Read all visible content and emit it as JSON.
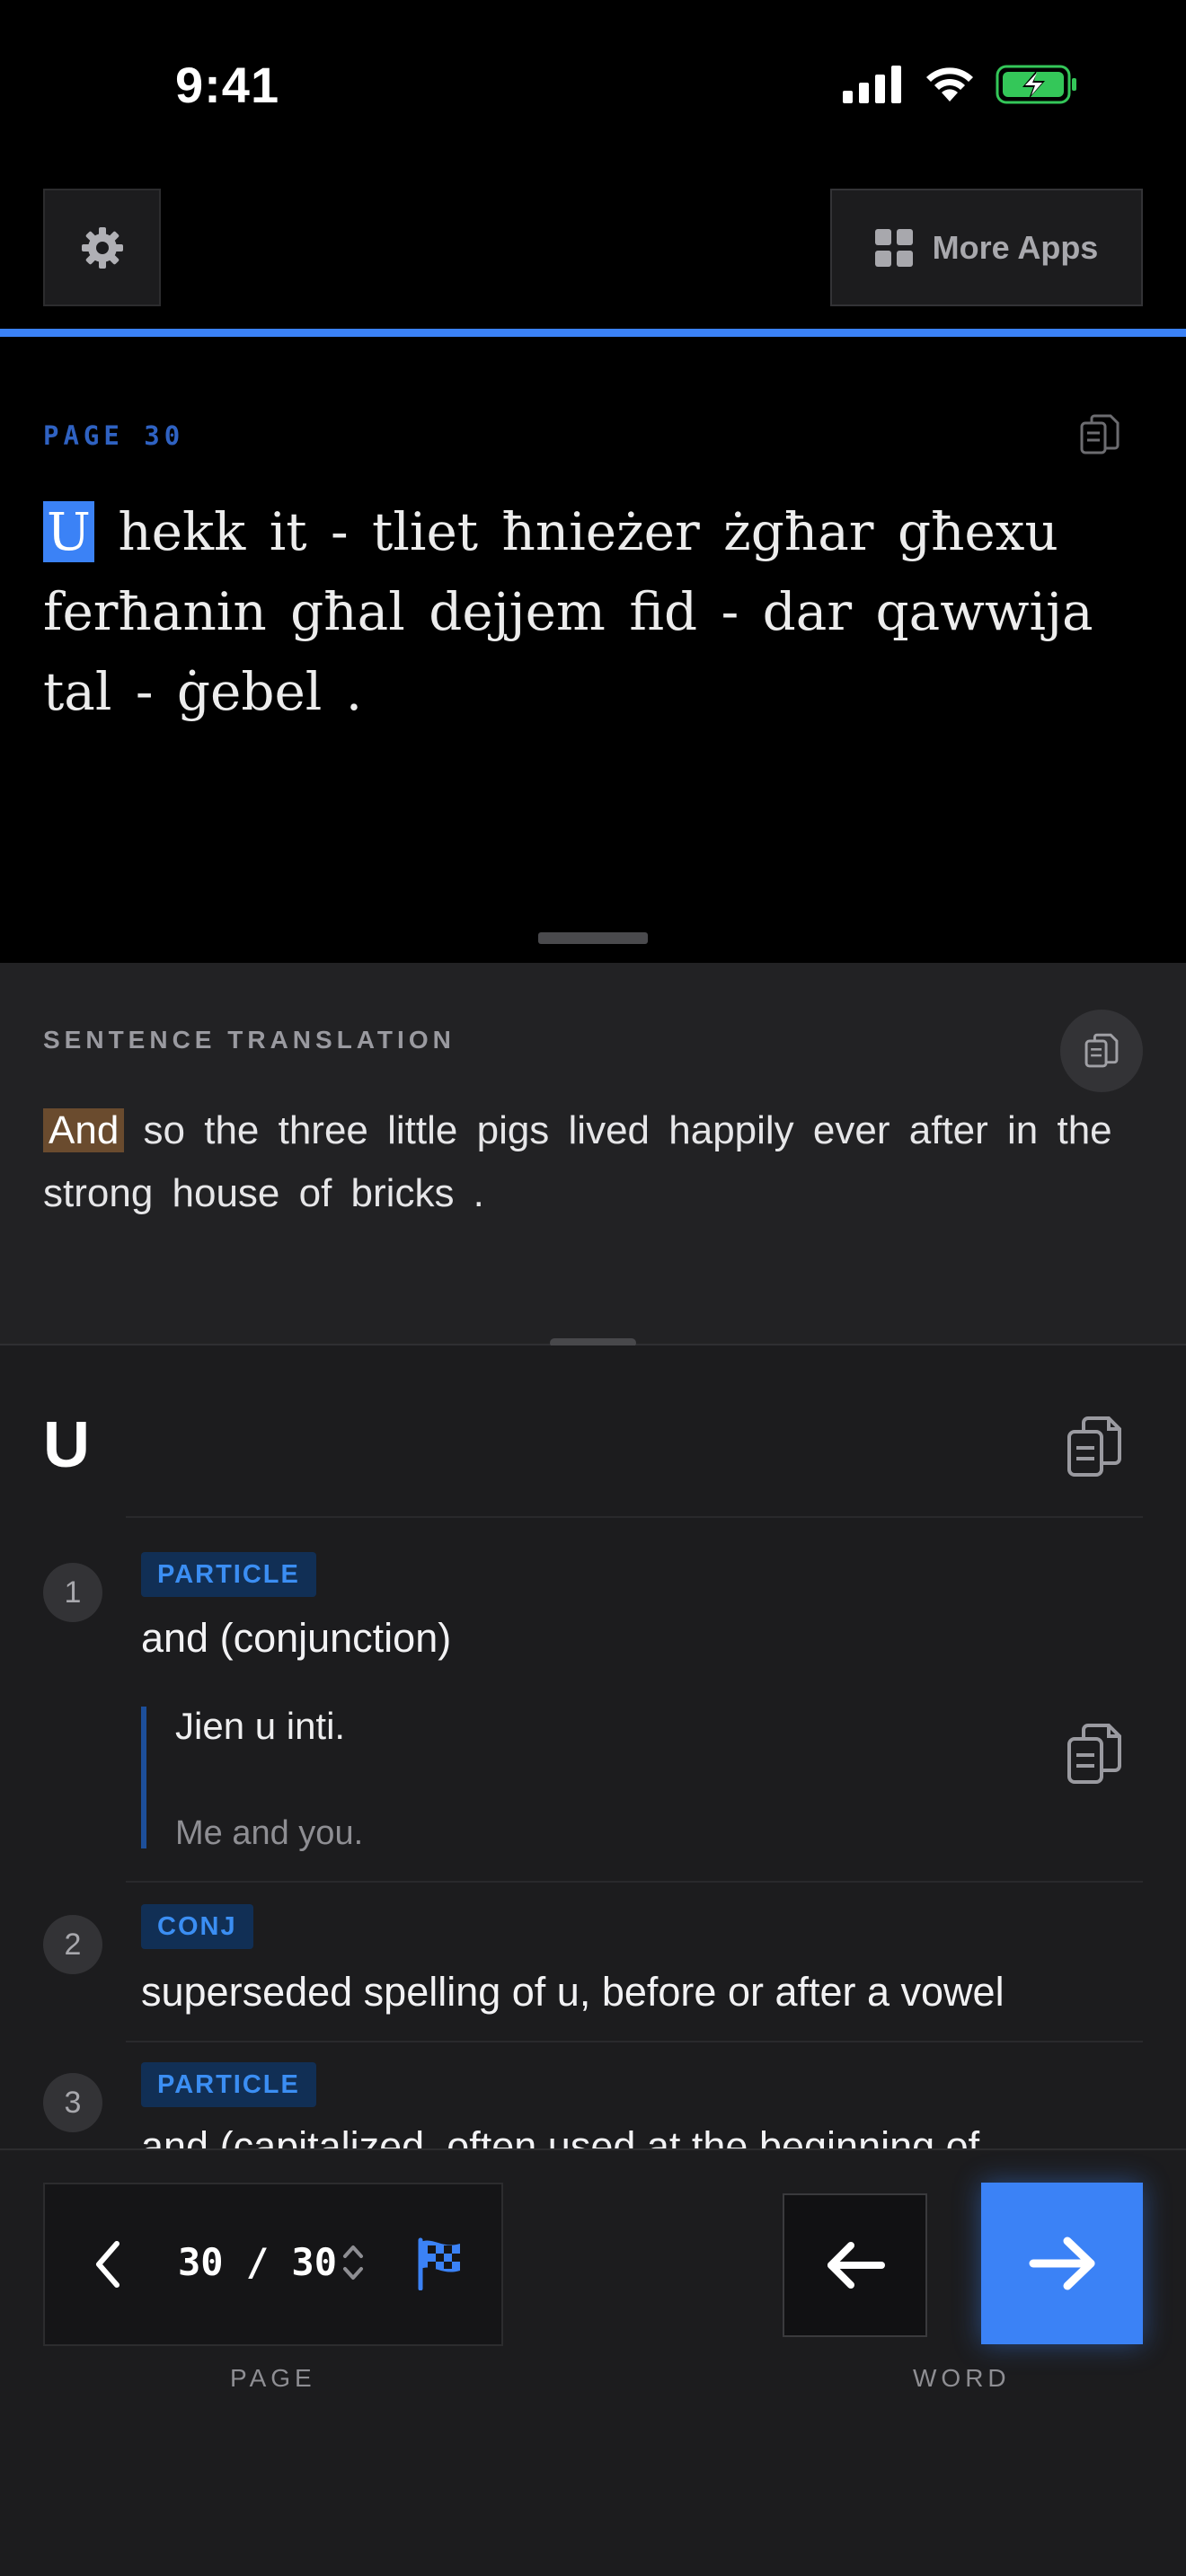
{
  "status_bar": {
    "time": "9:41"
  },
  "toolbar": {
    "settings_icon": "gear-icon",
    "more_apps_label": "More Apps",
    "more_apps_icon": "grid-icon"
  },
  "reader": {
    "page_label": "PAGE 30",
    "highlighted_word": "U",
    "text_rest": " hekk it - tliet ħnieżer żgħar għexu ferħanin għal dejjem fid - dar qawwija tal - ġebel ."
  },
  "translation": {
    "title": "SENTENCE TRANSLATION",
    "highlighted_word": "And",
    "text_rest": " so the three little pigs lived happily ever after in the strong house of bricks ."
  },
  "dictionary": {
    "word": "U",
    "senses": [
      {
        "number": "1",
        "pos": "PARTICLE",
        "definition": "and (conjunction)",
        "example": "Jien u inti.",
        "example_translation": "Me and you."
      },
      {
        "number": "2",
        "pos": "CONJ",
        "definition": "superseded spelling of u, before or after a vowel"
      },
      {
        "number": "3",
        "pos": "PARTICLE",
        "definition": "and (capitalized, often used at the beginning of"
      }
    ]
  },
  "navigation": {
    "page_count": "30 / 30",
    "page_caption": "PAGE",
    "word_caption": "WORD"
  },
  "colors": {
    "accent": "#3b82f6",
    "translation_highlight": "#6a4b2e",
    "badge_text": "#3b8ef3",
    "battery_green": "#34c759"
  }
}
